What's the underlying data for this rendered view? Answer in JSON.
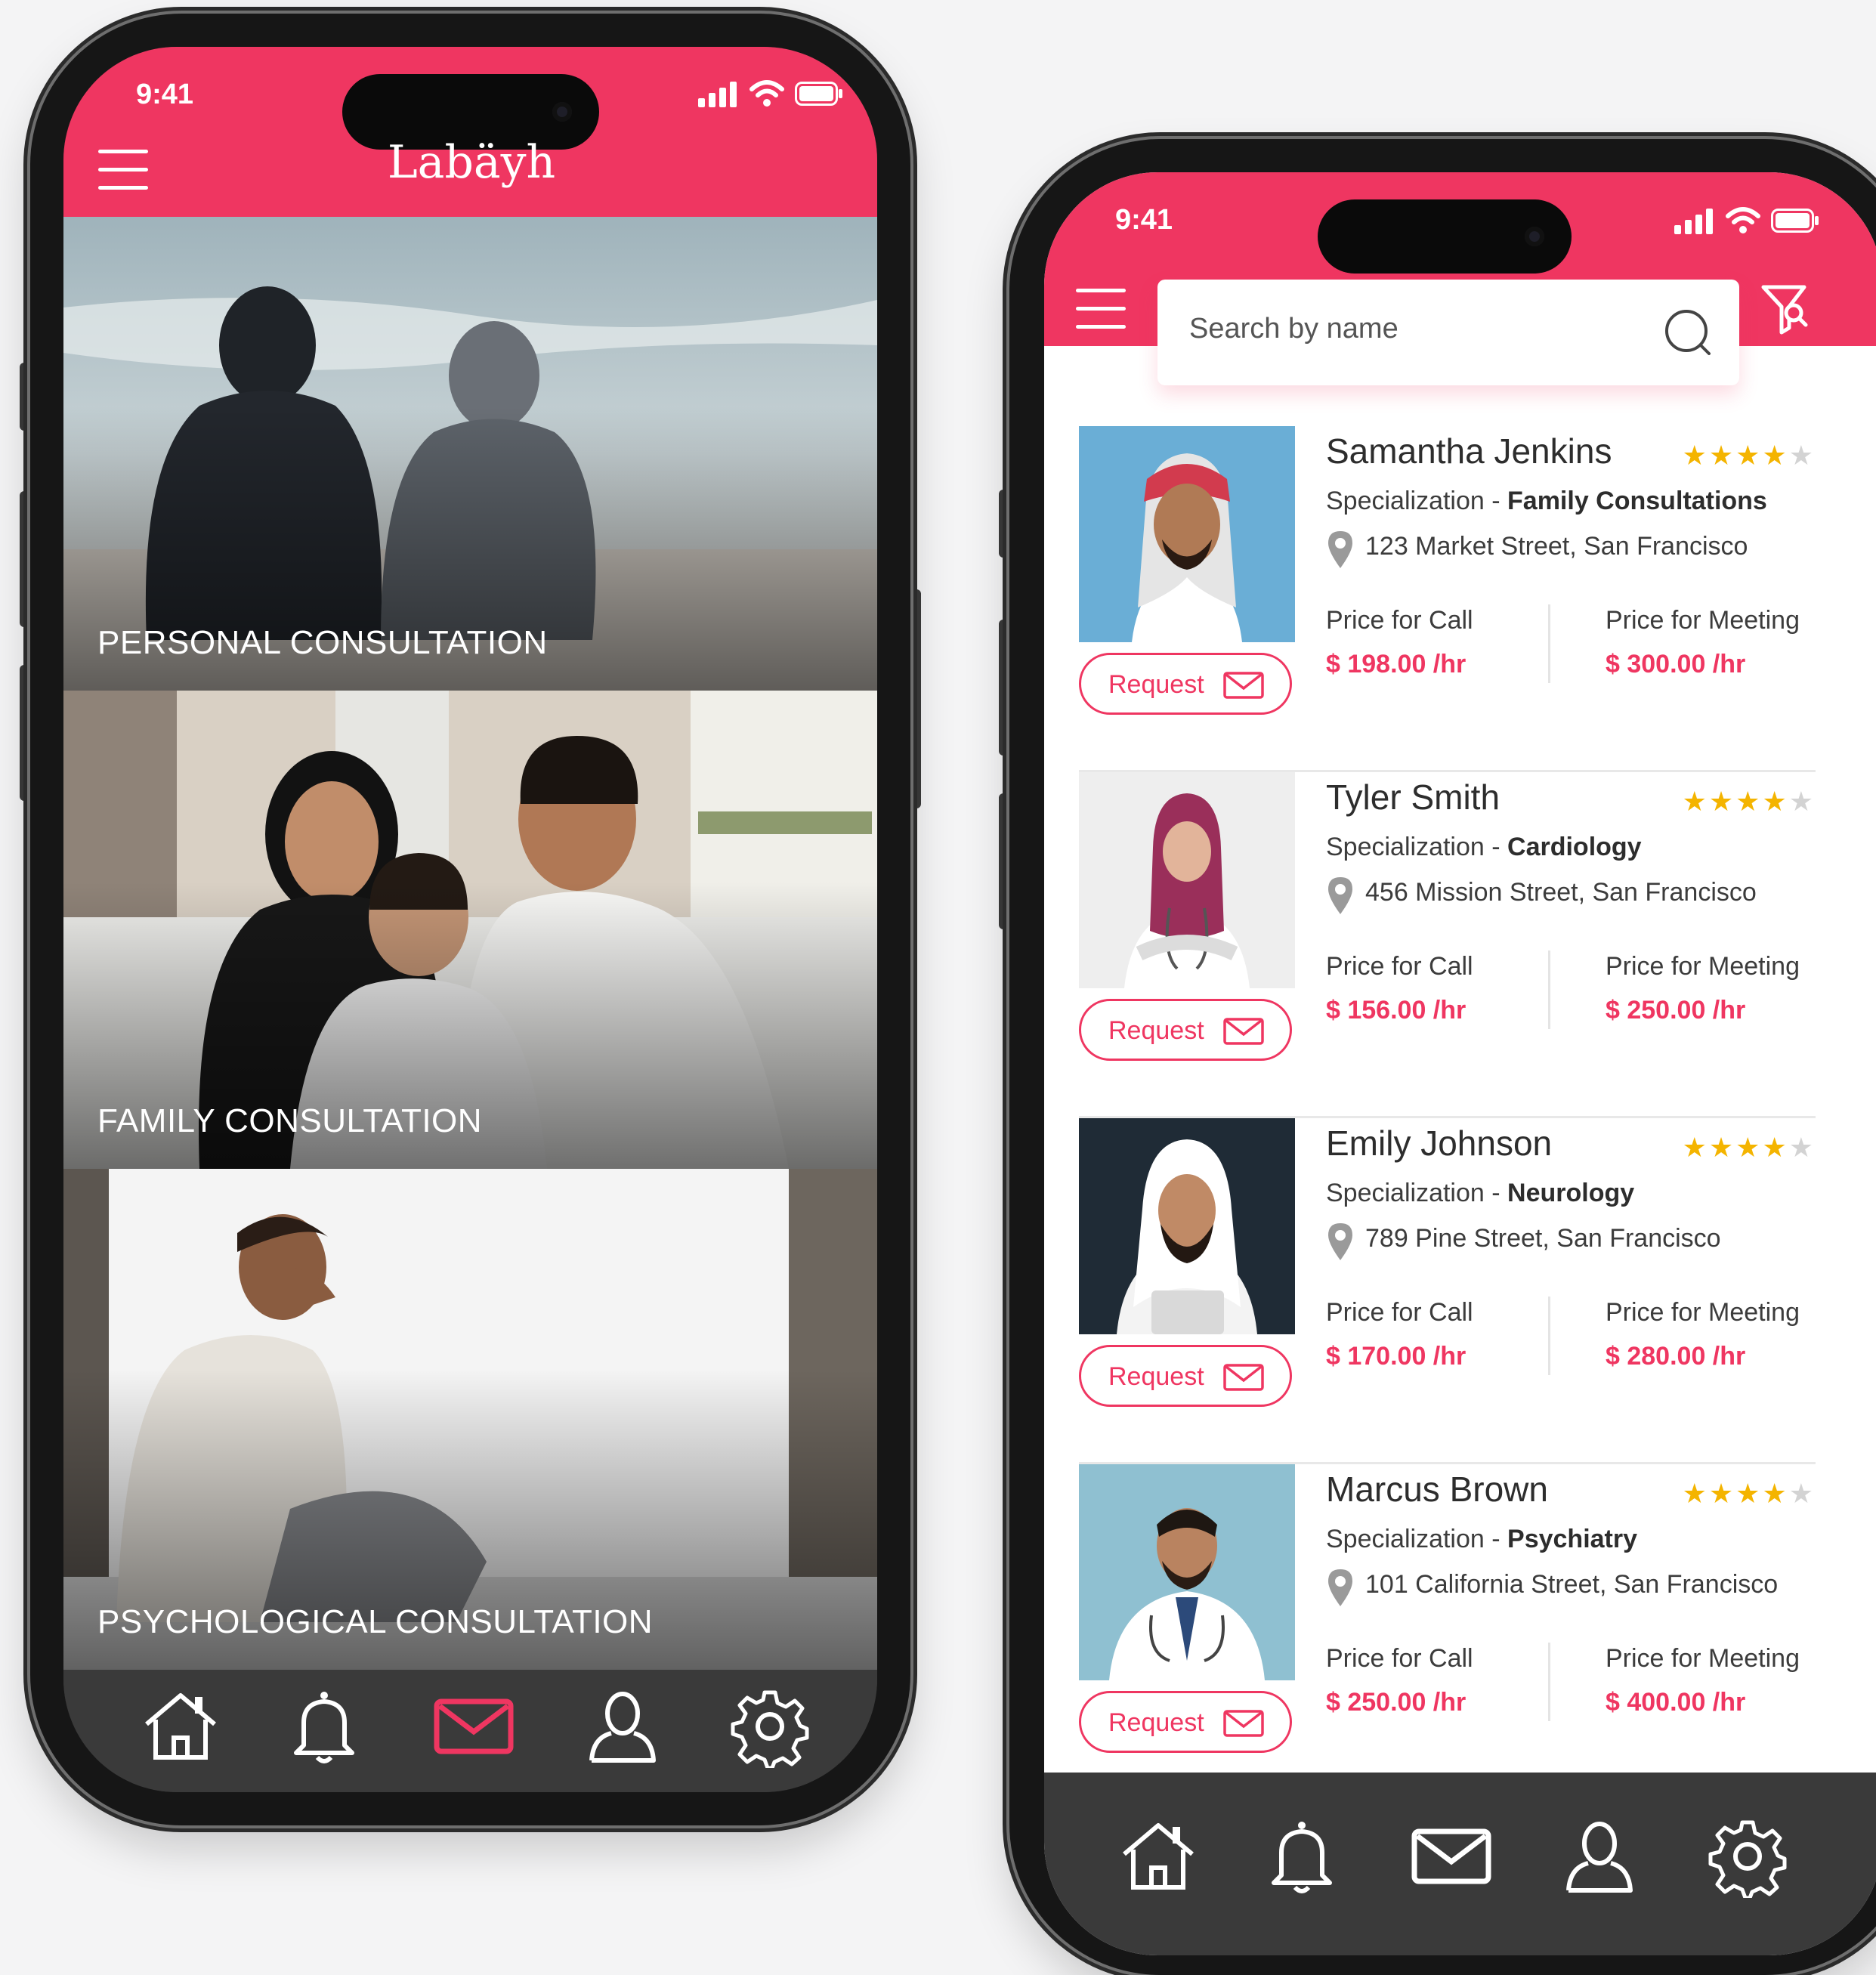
{
  "colors": {
    "accent": "#ef3661",
    "navbar": "#3a3a3a",
    "star_on": "#f4b400",
    "star_off": "#d3d3d3"
  },
  "home_screen": {
    "status_time": "9:41",
    "brand": "Labäyh",
    "tiles": [
      {
        "label": "PERSONAL CONSULTATION"
      },
      {
        "label": "FAMILY CONSULTATION"
      },
      {
        "label": "PSYCHOLOGICAL CONSULTATION"
      }
    ],
    "nav": [
      "home-icon",
      "bell-icon",
      "mail-icon",
      "user-icon",
      "settings-icon"
    ],
    "nav_active": "mail-icon"
  },
  "list_screen": {
    "status_time": "9:41",
    "search": {
      "placeholder": "Search by name"
    },
    "consultants": [
      {
        "name": "Samantha Jenkins",
        "rating": 4,
        "max_rating": 5,
        "spec_prefix": "Specialization - ",
        "specialization": "Family Consultations",
        "address": "123 Market Street, San Francisco",
        "call_label": "Price for Call",
        "call_price": "$ 198.00 /hr",
        "meeting_label": "Price for Meeting",
        "meeting_price": "$ 300.00 /hr",
        "request_label": "Request"
      },
      {
        "name": "Tyler Smith",
        "rating": 4,
        "max_rating": 5,
        "spec_prefix": "Specialization - ",
        "specialization": "Cardiology",
        "address": "456 Mission Street, San Francisco",
        "call_label": "Price for Call",
        "call_price": "$ 156.00 /hr",
        "meeting_label": "Price for Meeting",
        "meeting_price": "$ 250.00 /hr",
        "request_label": "Request"
      },
      {
        "name": "Emily Johnson",
        "rating": 4,
        "max_rating": 5,
        "spec_prefix": "Specialization - ",
        "specialization": "Neurology",
        "address": "789 Pine Street, San Francisco",
        "call_label": "Price for Call",
        "call_price": "$ 170.00 /hr",
        "meeting_label": "Price for Meeting",
        "meeting_price": "$ 280.00 /hr",
        "request_label": "Request"
      },
      {
        "name": "Marcus Brown",
        "rating": 4,
        "max_rating": 5,
        "spec_prefix": "Specialization - ",
        "specialization": "Psychiatry",
        "address": "101 California Street, San Francisco",
        "call_label": "Price for Call",
        "call_price": "$ 250.00 /hr",
        "meeting_label": "Price for Meeting",
        "meeting_price": "$ 400.00 /hr",
        "request_label": "Request"
      }
    ],
    "nav": [
      "home-icon",
      "bell-icon",
      "mail-icon",
      "user-icon",
      "settings-icon"
    ]
  }
}
